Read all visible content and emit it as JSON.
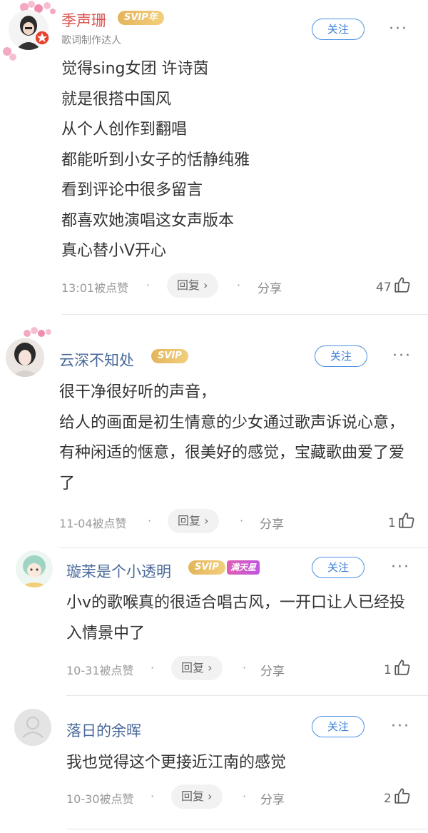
{
  "comments": [
    {
      "username": "季声珊",
      "badge": "SVIP年",
      "subtitle": "歌词制作达人",
      "follow_label": "关注",
      "more_label": "···",
      "lines": [
        "觉得sing女团 许诗茵",
        "就是很搭中国风",
        "从个人创作到翻唱",
        "都能听到小女子的恬静纯雅",
        "看到评论中很多留言",
        "都喜欢她演唱这女声版本",
        "真心替小V开心"
      ],
      "time": "13:01被点赞",
      "reply_label": "回复 ›",
      "share_label": "分享",
      "likes": "47",
      "name_color": "#d9534f"
    },
    {
      "username": "云深不知处",
      "badge": "SVIP",
      "follow_label": "关注",
      "more_label": "···",
      "lines": [
        "很干净很好听的声音，",
        "给人的画面是初生情意的少女通过歌声诉说心意，有种闲适的惬意，很美好的感觉，宝藏歌曲爱了爱了"
      ],
      "time": "11-04被点赞",
      "reply_label": "回复 ›",
      "share_label": "分享",
      "likes": "1",
      "name_color": "#4a6a9a"
    },
    {
      "username": "璇茉是个小透明",
      "badge": "SVIP",
      "badge2": "满天星",
      "follow_label": "关注",
      "more_label": "···",
      "lines": [
        "小v的歌喉真的很适合唱古风，一开口让人已经投入情景中了"
      ],
      "time": "10-31被点赞",
      "reply_label": "回复 ›",
      "share_label": "分享",
      "likes": "1",
      "name_color": "#4a6a9a"
    },
    {
      "username": "落日的余晖",
      "follow_label": "关注",
      "more_label": "···",
      "lines": [
        "我也觉得这个更接近江南的感觉"
      ],
      "time": "10-30被点赞",
      "reply_label": "回复 ›",
      "share_label": "分享",
      "likes": "2",
      "name_color": "#4a6a9a"
    }
  ]
}
